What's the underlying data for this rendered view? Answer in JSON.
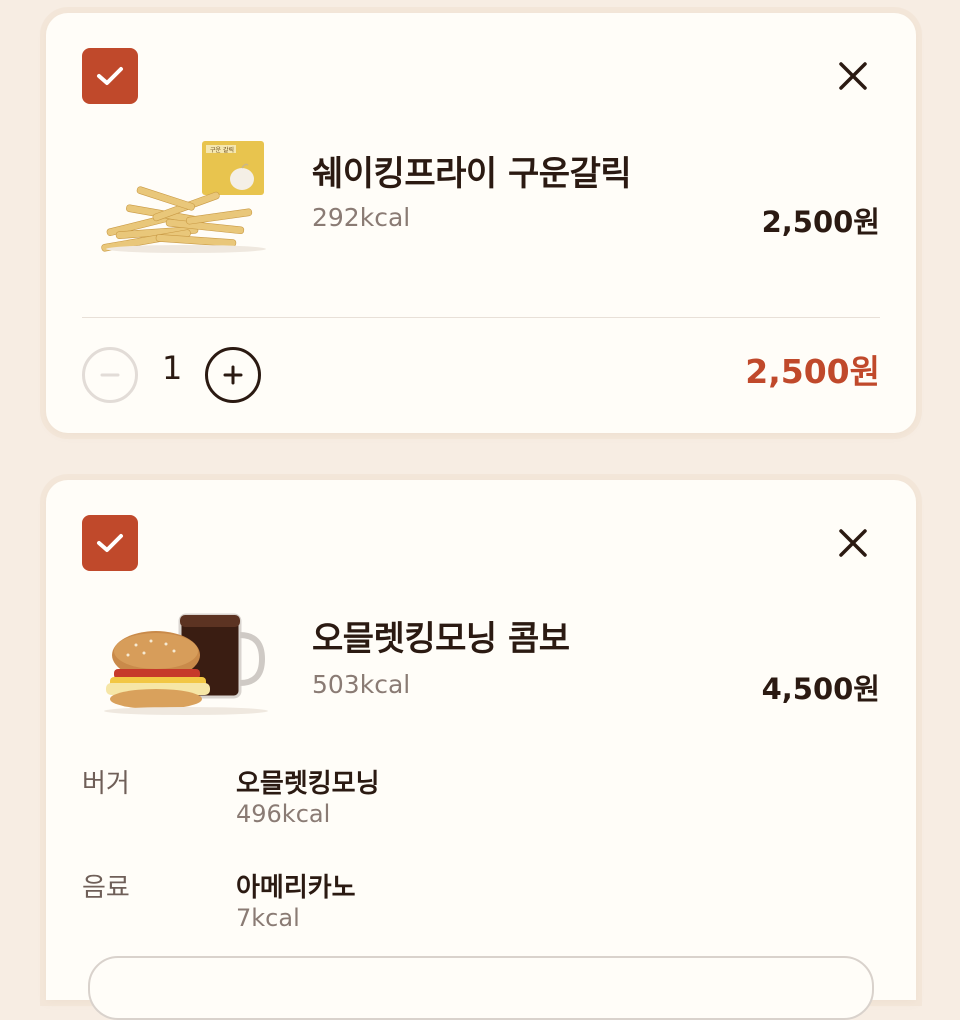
{
  "items": [
    {
      "name": "쉐이킹프라이 구운갈릭",
      "kcal": "292kcal",
      "price": "2,500원",
      "quantity": "1",
      "total": "2,500원",
      "checked": true,
      "image_package_text": "구운 갈릭"
    },
    {
      "name": "오믈렛킹모닝 콤보",
      "kcal": "503kcal",
      "price": "4,500원",
      "checked": true,
      "options": [
        {
          "label": "버거",
          "name": "오믈렛킹모닝",
          "kcal": "496kcal"
        },
        {
          "label": "음료",
          "name": "아메리카노",
          "kcal": "7kcal"
        }
      ]
    }
  ],
  "colors": {
    "accent": "#c0492b",
    "background": "#f7ede3",
    "card": "#fffdf8",
    "text": "#2b1a12",
    "muted": "#8a7b74"
  },
  "icons": {
    "checkbox": "check-icon",
    "close": "close-icon",
    "minus": "minus-icon",
    "plus": "plus-icon"
  }
}
